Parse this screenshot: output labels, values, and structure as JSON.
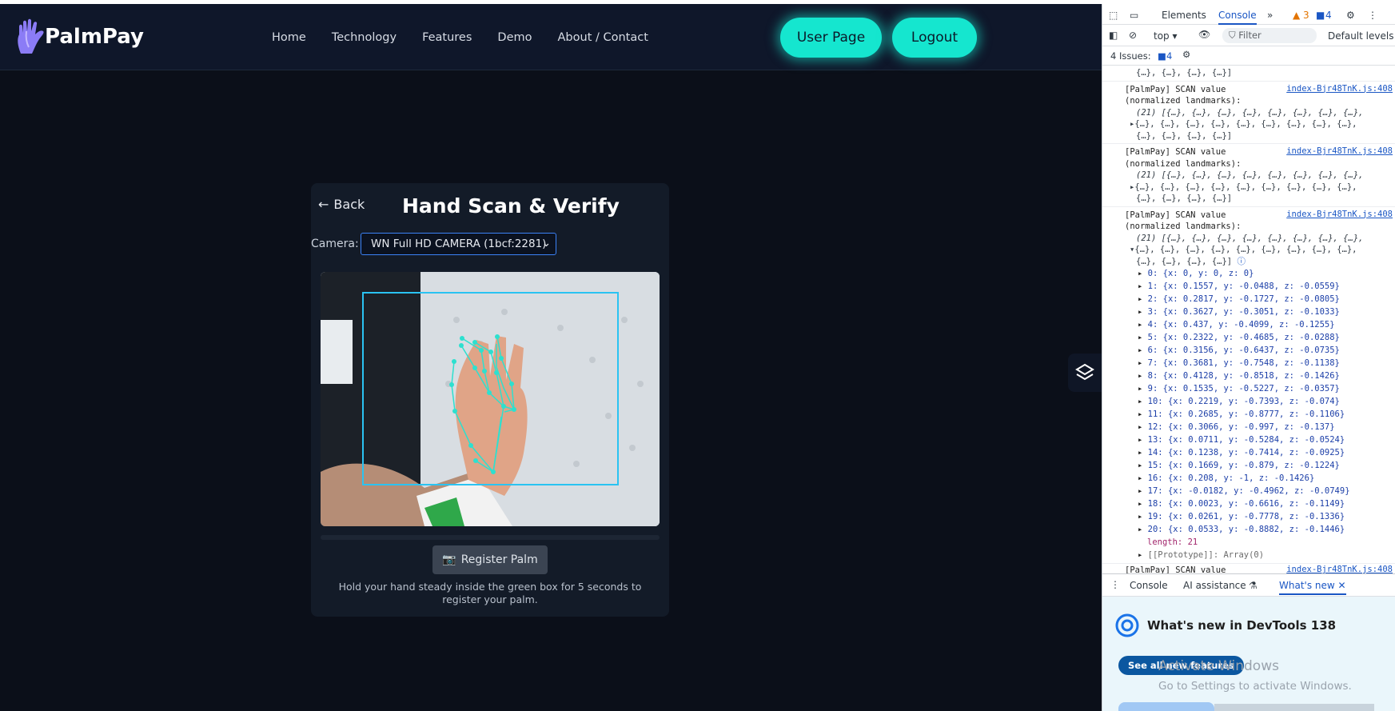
{
  "app": {
    "logo_text": "PalmPay",
    "logo_glyph": "P",
    "nav": [
      "Home",
      "Technology",
      "Features",
      "Demo",
      "About / Contact"
    ],
    "user_page_label": "User Page",
    "logout_label": "Logout",
    "back_label": "Back",
    "title": "Hand Scan & Verify",
    "camera_label": "Camera:",
    "camera_value": "WN Full HD CAMERA (1bcf:2281)",
    "register_label": "Register Palm",
    "hint": "Hold your hand steady inside the green box for 5 seconds to register your palm.",
    "accent_color": "#15e6cf",
    "scan_box_color": "#2ac3f2"
  },
  "devtools": {
    "tabs": [
      "Elements",
      "Console"
    ],
    "warnings": "3",
    "messages": "4",
    "context": "top",
    "filter_placeholder": "Filter",
    "levels": "Default levels",
    "issues_label": "4 Issues:",
    "issues_count": "4",
    "prev_tail": "{…}, {…}, {…}, {…}]",
    "log_head": "[PalmPay] SCAN value",
    "log_head2": "(normalized landmarks):",
    "source": "index-Bjr48TnK.js:408",
    "collapsed_line1": "(21) [{…}, {…}, {…}, {…}, {…}, {…}, {…}, {…},",
    "collapsed_line2": "{…}, {…}, {…}, {…}, {…}, {…}, {…}, {…}, {…},",
    "collapsed_line3": "{…}, {…}, {…}, {…}]",
    "landmarks": [
      "0: {x: 0, y: 0, z: 0}",
      "1: {x: 0.1557, y: -0.0488, z: -0.0559}",
      "2: {x: 0.2817, y: -0.1727, z: -0.0805}",
      "3: {x: 0.3627, y: -0.3051, z: -0.1033}",
      "4: {x: 0.437, y: -0.4099, z: -0.1255}",
      "5: {x: 0.2322, y: -0.4685, z: -0.0288}",
      "6: {x: 0.3156, y: -0.6437, z: -0.0735}",
      "7: {x: 0.3681, y: -0.7548, z: -0.1138}",
      "8: {x: 0.4128, y: -0.8518, z: -0.1426}",
      "9: {x: 0.1535, y: -0.5227, z: -0.0357}",
      "10: {x: 0.2219, y: -0.7393, z: -0.074}",
      "11: {x: 0.2685, y: -0.8777, z: -0.1106}",
      "12: {x: 0.3066, y: -0.997, z: -0.137}",
      "13: {x: 0.0711, y: -0.5284, z: -0.0524}",
      "14: {x: 0.1238, y: -0.7414, z: -0.0925}",
      "15: {x: 0.1669, y: -0.879, z: -0.1224}",
      "16: {x: 0.208, y: -1, z: -0.1426}",
      "17: {x: -0.0182, y: -0.4962, z: -0.0749}",
      "18: {x: 0.0023, y: -0.6616, z: -0.1149}",
      "19: {x: 0.0261, y: -0.7778, z: -0.1336}",
      "20: {x: 0.0533, y: -0.8882, z: -0.1446}"
    ],
    "length_line": "length: 21",
    "proto_line": "[[Prototype]]: Array(0)",
    "drawer_tabs": [
      "Console",
      "AI assistance",
      "What's new"
    ],
    "whatsnew_title": "What's new in DevTools 138",
    "see_all": "See all new features"
  },
  "os": {
    "activate_title": "Activate Windows",
    "activate_sub": "Go to Settings to activate Windows."
  }
}
